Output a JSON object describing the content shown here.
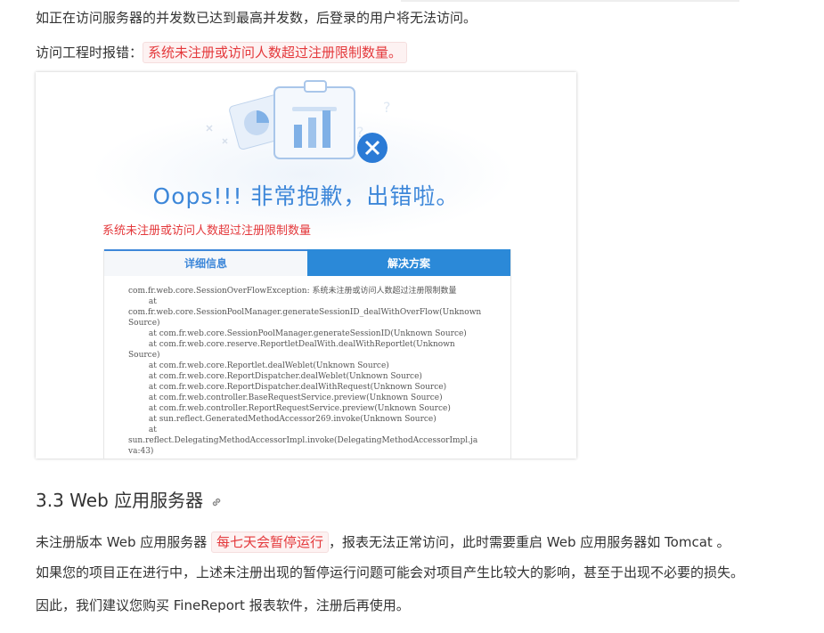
{
  "paragraph1": "如正在访问服务器的并发数已达到最高并发数，后登录的用户将无法访问。",
  "paragraph2": {
    "prefix": "访问工程时报错：",
    "highlight": "系统未注册或访问人数超过注册限制数量。"
  },
  "screenshot": {
    "oops_title": "Oops!!! 非常抱歉，出错啦。",
    "error_message": "系统未注册或访问人数超过注册限制数量",
    "tabs": [
      {
        "label": "详细信息",
        "active": true
      },
      {
        "label": "解决方案",
        "active": false
      }
    ],
    "stack_trace": [
      "com.fr.web.core.SessionOverFlowException: 系统未注册或访问人数超过注册限制数量",
      "        at",
      "com.fr.web.core.SessionPoolManager.generateSessionID_dealWithOverFlow(Unknown",
      "Source)",
      "        at com.fr.web.core.SessionPoolManager.generateSessionID(Unknown Source)",
      "        at com.fr.web.core.reserve.ReportletDealWith.dealWithReportlet(Unknown",
      "Source)",
      "        at com.fr.web.core.Reportlet.dealWeblet(Unknown Source)",
      "        at com.fr.web.core.ReportDispatcher.dealWeblet(Unknown Source)",
      "        at com.fr.web.core.ReportDispatcher.dealWithRequest(Unknown Source)",
      "        at com.fr.web.controller.BaseRequestService.preview(Unknown Source)",
      "        at com.fr.web.controller.ReportRequestService.preview(Unknown Source)",
      "        at sun.reflect.GeneratedMethodAccessor269.invoke(Unknown Source)",
      "        at",
      "sun.reflect.DelegatingMethodAccessorImpl.invoke(DelegatingMethodAccessorImpl.ja",
      "va:43)"
    ]
  },
  "section_heading": "3.3 Web 应用服务器",
  "paragraph3": {
    "prefix": "未注册版本 Web 应用服务器 ",
    "highlight": "每七天会暂停运行",
    "suffix": "，报表无法正常访问，此时需要重启 Web 应用服务器如 Tomcat 。"
  },
  "paragraph4": "如果您的项目正在进行中，上述未注册出现的暂停运行问题可能会对项目产生比较大的影响，甚至于出现不必要的损失。",
  "paragraph5": "因此，我们建议您购买 FineReport 报表软件，注册后再使用。",
  "colors": {
    "accent_blue": "#3d87d9",
    "tab_dark": "#2b89d8",
    "error_red": "#e4393c"
  }
}
